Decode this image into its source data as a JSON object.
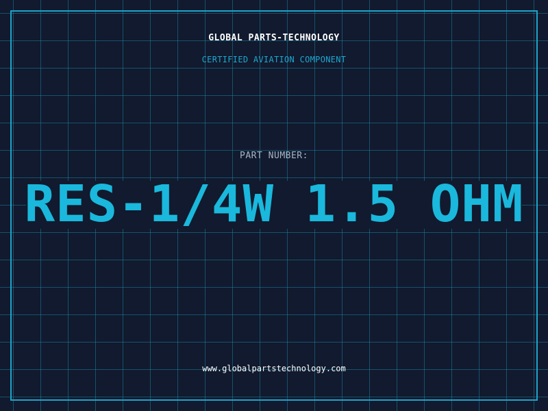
{
  "header": {
    "company": "GLOBAL PARTS-TECHNOLOGY",
    "subtitle": "CERTIFIED AVIATION COMPONENT"
  },
  "part": {
    "label": "PART NUMBER:",
    "number": "RES-1/4W 1.5 OHM"
  },
  "footer": {
    "website": "www.globalpartstechnology.com"
  },
  "colors": {
    "background": "#111a2e",
    "accent": "#1ab8dc",
    "grid": "#1d96b9",
    "text": "#ffffff",
    "muted": "#a9b6c6"
  }
}
